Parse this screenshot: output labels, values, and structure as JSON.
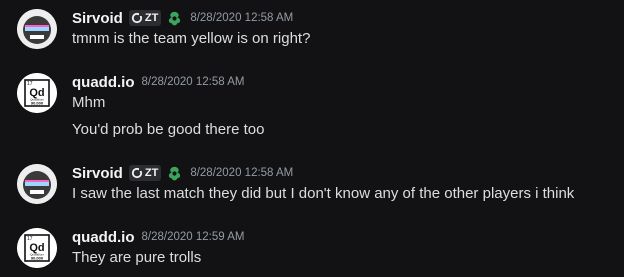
{
  "messages": [
    {
      "author": "Sirvoid",
      "tag": "ZT",
      "timestamp": "8/28/2020 12:58 AM",
      "lines": [
        "tmnm is the team yellow is on right?"
      ]
    },
    {
      "author": "quadd.io",
      "avatar_text": "Qd",
      "avatar_number": "17",
      "avatar_small": "Quaddium",
      "avatar_value": "90.000",
      "timestamp": "8/28/2020 12:58 AM",
      "lines": [
        "Mhm",
        "You'd prob be good there too"
      ]
    },
    {
      "author": "Sirvoid",
      "tag": "ZT",
      "timestamp": "8/28/2020 12:58 AM",
      "lines": [
        "I saw the last match they did but I don't know any of the other players i think"
      ]
    },
    {
      "author": "quadd.io",
      "avatar_text": "Qd",
      "avatar_number": "17",
      "avatar_small": "Quaddium",
      "avatar_value": "90.000",
      "timestamp": "8/28/2020 12:59 AM",
      "lines": [
        "They are pure trolls"
      ]
    }
  ],
  "icons": {
    "tag_icon": "ring-icon",
    "badge": "leaf-badge-icon"
  },
  "colors": {
    "background": "#121214",
    "username": "#f2f3f5",
    "timestamp": "#949ba4",
    "badge_green": "#3ba55c"
  }
}
